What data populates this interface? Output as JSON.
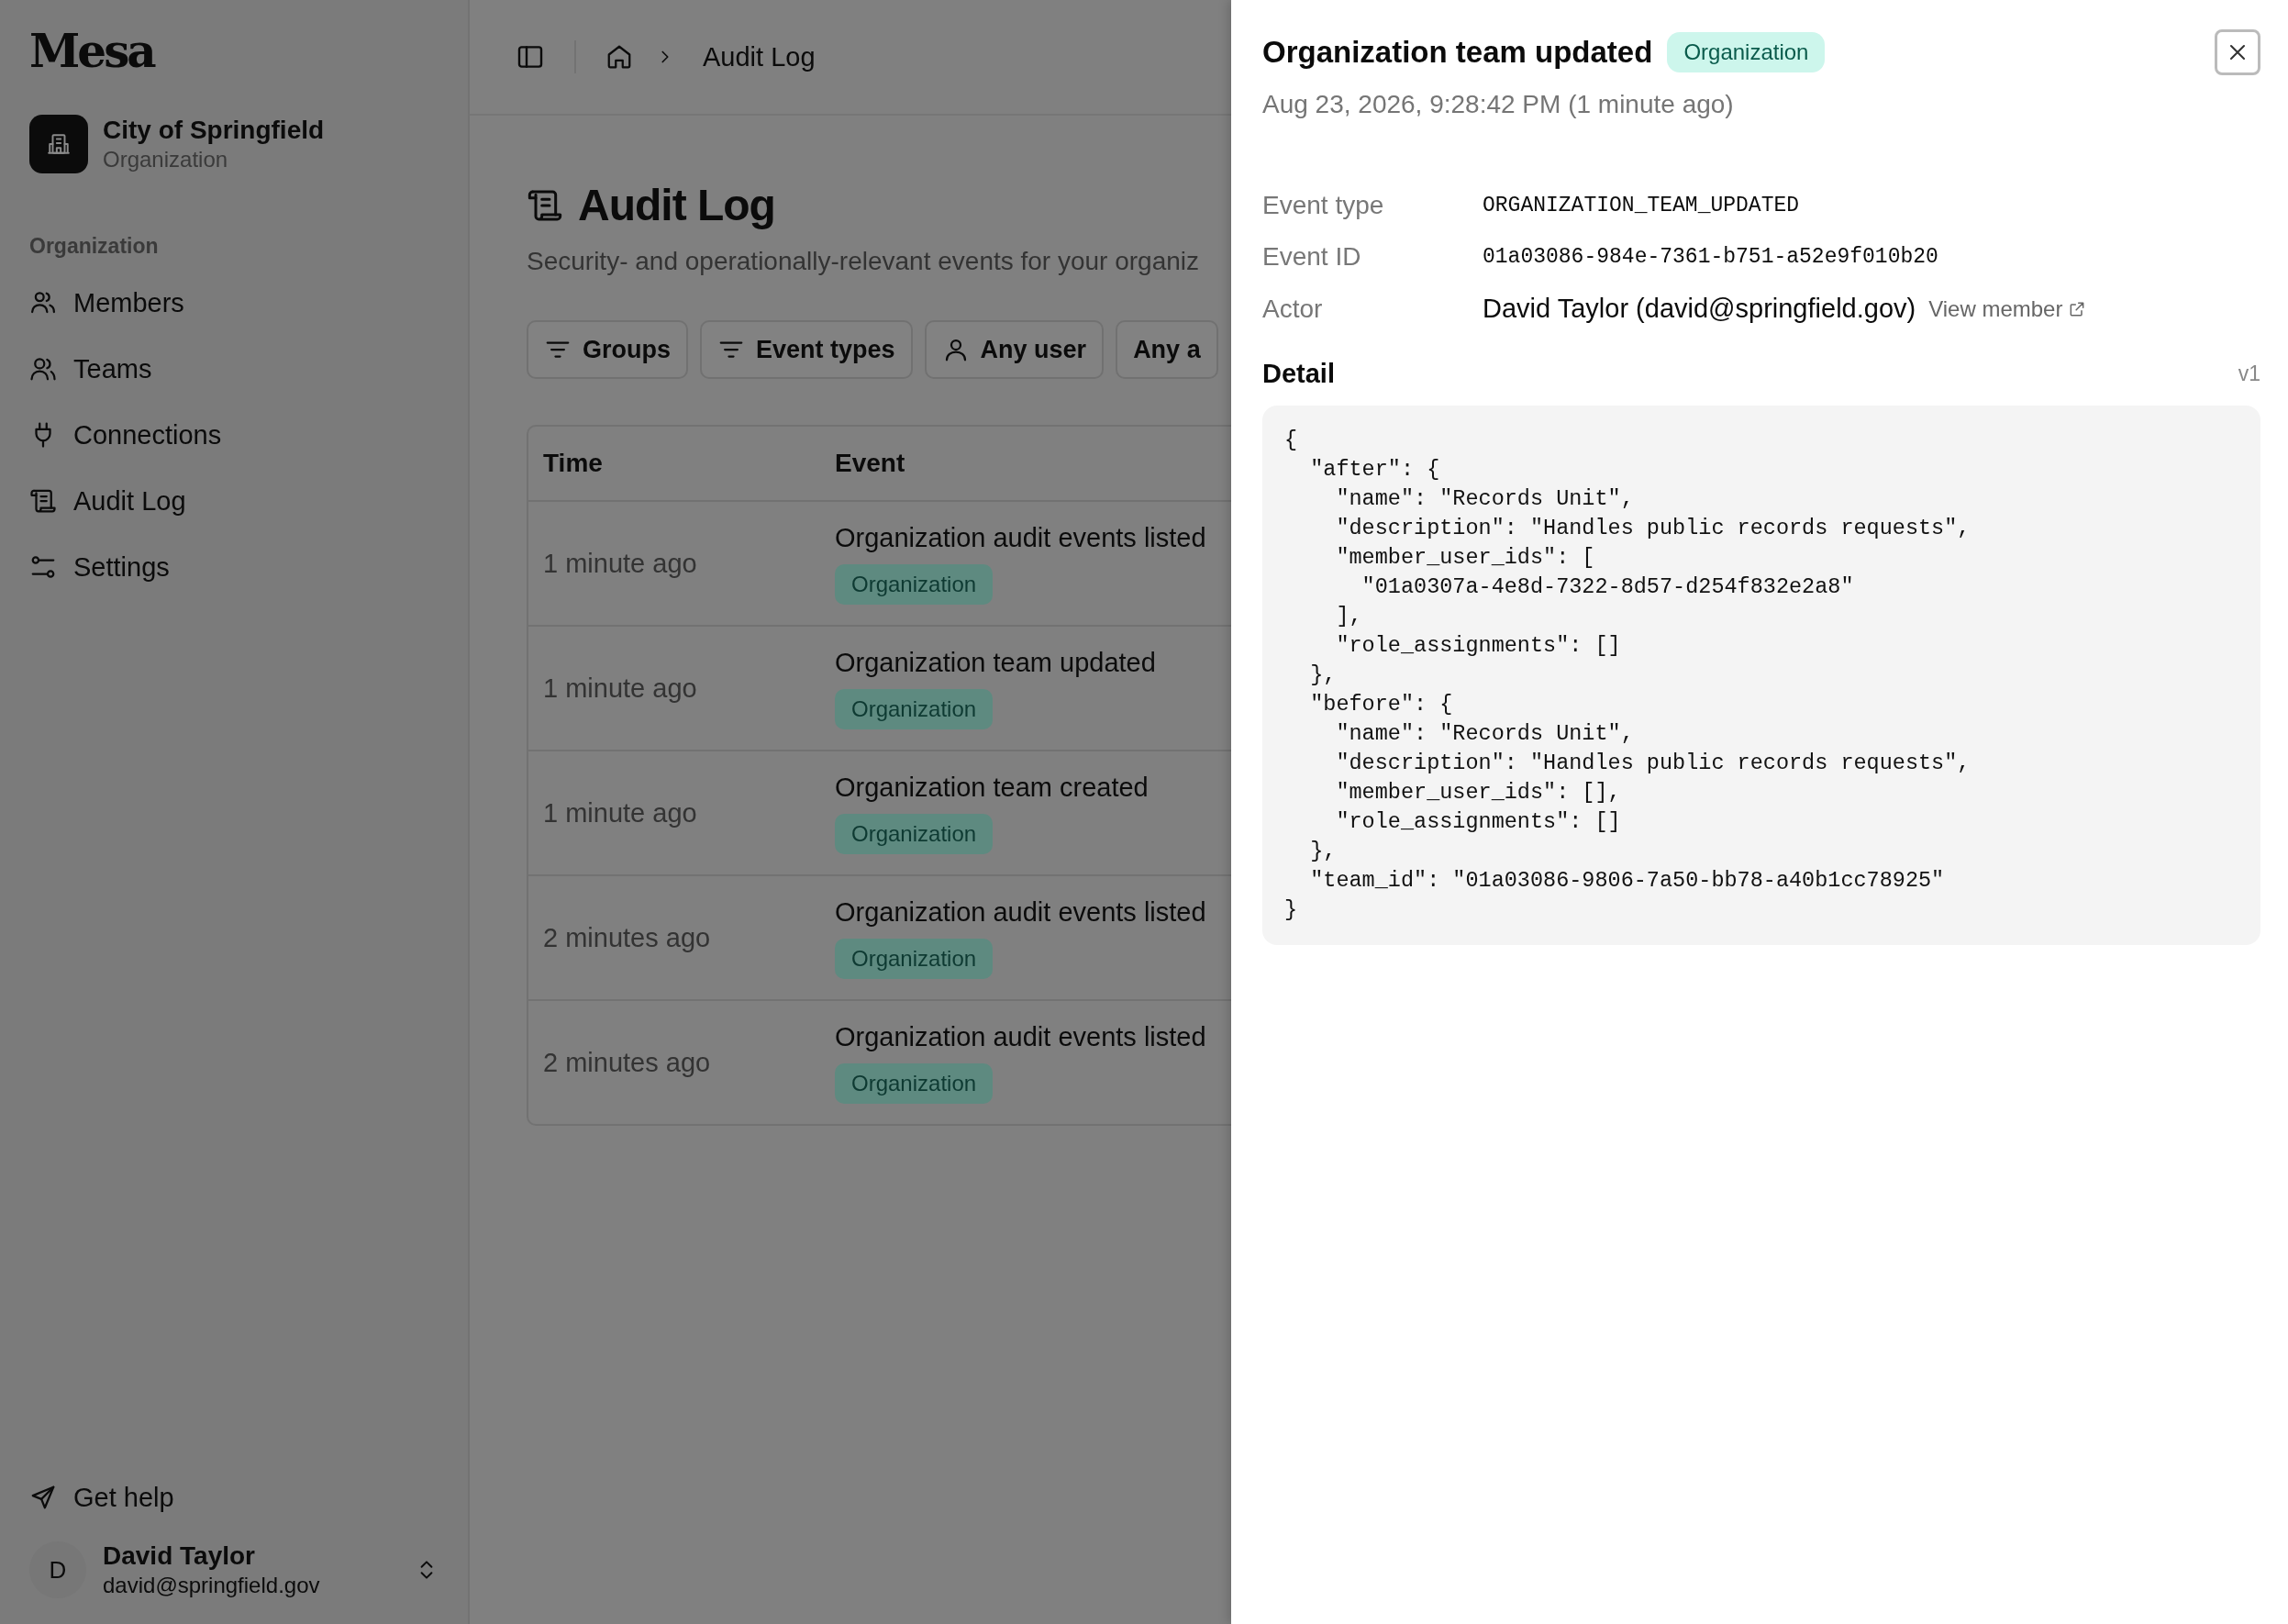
{
  "sidebar": {
    "logo": "Mesa",
    "org": {
      "name": "City of Springfield",
      "type": "Organization"
    },
    "section_label": "Organization",
    "items": [
      {
        "label": "Members"
      },
      {
        "label": "Teams"
      },
      {
        "label": "Connections"
      },
      {
        "label": "Audit Log"
      },
      {
        "label": "Settings"
      }
    ],
    "help": "Get help",
    "user": {
      "initial": "D",
      "name": "David Taylor",
      "email": "david@springfield.gov"
    }
  },
  "breadcrumb": {
    "current": "Audit Log"
  },
  "page": {
    "title": "Audit Log",
    "subtitle": "Security- and operationally-relevant events for your organiz",
    "filters": [
      {
        "label": "Groups"
      },
      {
        "label": "Event types"
      },
      {
        "label": "Any user"
      },
      {
        "label": "Any a"
      }
    ]
  },
  "table": {
    "columns": [
      "Time",
      "Event"
    ],
    "rows": [
      {
        "time": "1 minute ago",
        "event": "Organization audit events listed",
        "tag": "Organization"
      },
      {
        "time": "1 minute ago",
        "event": "Organization team updated",
        "tag": "Organization"
      },
      {
        "time": "1 minute ago",
        "event": "Organization team created",
        "tag": "Organization"
      },
      {
        "time": "2 minutes ago",
        "event": "Organization audit events listed",
        "tag": "Organization"
      },
      {
        "time": "2 minutes ago",
        "event": "Organization audit events listed",
        "tag": "Organization"
      }
    ]
  },
  "drawer": {
    "title": "Organization team updated",
    "tag": "Organization",
    "timestamp": "Aug 23, 2026, 9:28:42 PM (1 minute ago)",
    "fields": [
      {
        "label": "Event type",
        "value": "ORGANIZATION_TEAM_UPDATED",
        "kind": "code"
      },
      {
        "label": "Event ID",
        "value": "01a03086-984e-7361-b751-a52e9f010b20",
        "kind": "code"
      },
      {
        "label": "Actor",
        "value": "David Taylor (david@springfield.gov)",
        "link": "View member",
        "kind": "text"
      }
    ],
    "detail_label": "Detail",
    "version": "v1",
    "detail": "{\n  \"after\": {\n    \"name\": \"Records Unit\",\n    \"description\": \"Handles public records requests\",\n    \"member_user_ids\": [\n      \"01a0307a-4e8d-7322-8d57-d254f832e2a8\"\n    ],\n    \"role_assignments\": []\n  },\n  \"before\": {\n    \"name\": \"Records Unit\",\n    \"description\": \"Handles public records requests\",\n    \"member_user_ids\": [],\n    \"role_assignments\": []\n  },\n  \"team_id\": \"01a03086-9806-7a50-bb78-a40b1cc78925\"\n}"
  }
}
